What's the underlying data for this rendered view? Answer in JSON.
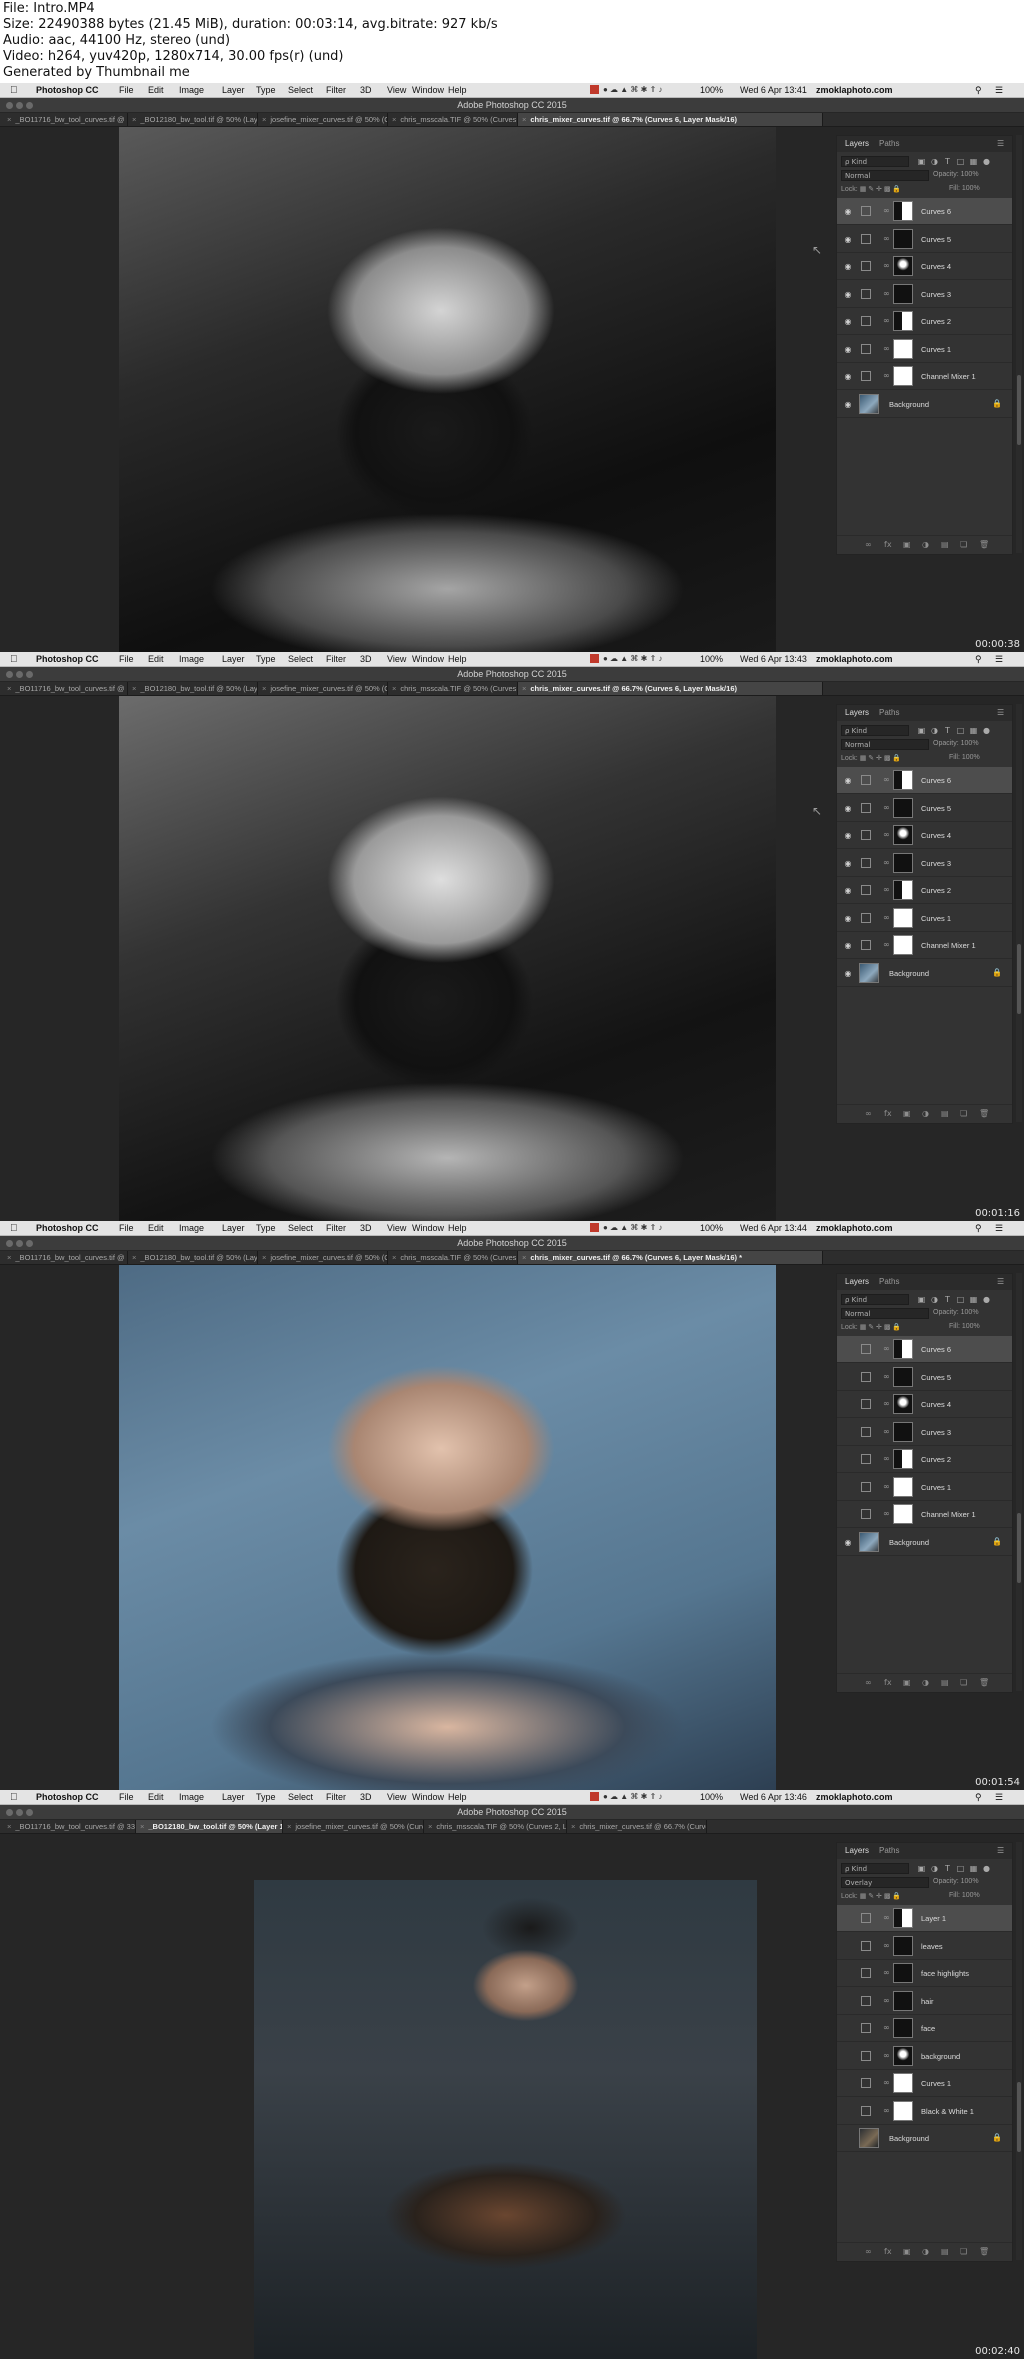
{
  "header": {
    "lines": [
      "File: Intro.MP4",
      "Size: 22490388 bytes (21.45 MiB), duration: 00:03:14, avg.bitrate: 927 kb/s",
      "Audio: aac, 44100 Hz, stereo (und)",
      "Video: h264, yuv420p, 1280x714, 30.00 fps(r) (und)",
      "Generated by Thumbnail me"
    ]
  },
  "menu": {
    "apple": "",
    "app": "Photoshop CC",
    "items": [
      "File",
      "Edit",
      "Image",
      "Layer",
      "Type",
      "Select",
      "Filter",
      "3D",
      "View",
      "Window",
      "Help"
    ],
    "battery": "100%",
    "user": "zmoklaphoto.com"
  },
  "window_title": "Adobe Photoshop CC 2015",
  "panel": {
    "tab_layers": "Layers",
    "tab_paths": "Paths",
    "kind": "ρ Kind",
    "opacity_label": "Opacity:",
    "fill_label": "Fill:",
    "lock_label": "Lock:",
    "icons": [
      "link-icon",
      "fx-icon",
      "mask-icon",
      "adjustment-icon",
      "folder-icon",
      "new-layer-icon",
      "trash-icon"
    ]
  },
  "frames": [
    {
      "time": "Wed 6 Apr 13:41",
      "timestamp": "00:00:38",
      "tabs": [
        "_BO11716_bw_tool_curves.tif @ 33.3%...",
        "_BO12180_bw_tool.tif @ 50% (Layer 1,...",
        "josefine_mixer_curves.tif @ 50% (Curve...",
        "chris_msscala.TIF @ 50% (Curves 2, La...",
        "chris_mixer_curves.tif @ 66.7% (Curves 6, Layer Mask/16)"
      ],
      "active_tab": 4,
      "blend": "Normal",
      "opacity": "100%",
      "fill": "100%",
      "layers": [
        {
          "name": "Curves 6",
          "thumb": "half",
          "sel": true
        },
        {
          "name": "Curves 5",
          "thumb": "dark"
        },
        {
          "name": "Curves 4",
          "thumb": "mostdark"
        },
        {
          "name": "Curves 3",
          "thumb": "dark"
        },
        {
          "name": "Curves 2",
          "thumb": "half"
        },
        {
          "name": "Curves 1",
          "thumb": "white"
        },
        {
          "name": "Channel Mixer 1",
          "thumb": "white"
        },
        {
          "name": "Background",
          "thumb": "bg",
          "lock": true
        }
      ]
    },
    {
      "time": "Wed 6 Apr 13:43",
      "timestamp": "00:01:16",
      "tabs": [
        "_BO11716_bw_tool_curves.tif @ 33.3%...",
        "_BO12180_bw_tool.tif @ 50% (Layer 1,...",
        "josefine_mixer_curves.tif @ 50% (Curve...",
        "chris_msscala.TIF @ 50% (Curves 2, La...",
        "chris_mixer_curves.tif @ 66.7% (Curves 6, Layer Mask/16)"
      ],
      "active_tab": 4,
      "blend": "Normal",
      "opacity": "100%",
      "fill": "100%",
      "layers": [
        {
          "name": "Curves 6",
          "thumb": "half",
          "sel": true
        },
        {
          "name": "Curves 5",
          "thumb": "dark"
        },
        {
          "name": "Curves 4",
          "thumb": "mostdark"
        },
        {
          "name": "Curves 3",
          "thumb": "dark"
        },
        {
          "name": "Curves 2",
          "thumb": "half"
        },
        {
          "name": "Curves 1",
          "thumb": "white"
        },
        {
          "name": "Channel Mixer 1",
          "thumb": "white"
        },
        {
          "name": "Background",
          "thumb": "bg",
          "lock": true
        }
      ]
    },
    {
      "time": "Wed 6 Apr 13:44",
      "timestamp": "00:01:54",
      "tabs": [
        "_BO11716_bw_tool_curves.tif @ 33.3%...",
        "_BO12180_bw_tool.tif @ 50% (Layer 1,...",
        "josefine_mixer_curves.tif @ 50% (Curv...",
        "chris_msscala.TIF @ 50% (Curves 2, La...",
        "chris_mixer_curves.tif @ 66.7% (Curves 6, Layer Mask/16) *"
      ],
      "active_tab": 4,
      "blend": "Normal",
      "opacity": "100%",
      "fill": "100%",
      "layers": [
        {
          "name": "Curves 6",
          "thumb": "half",
          "sel": true,
          "hidden": true
        },
        {
          "name": "Curves 5",
          "thumb": "dark",
          "hidden": true
        },
        {
          "name": "Curves 4",
          "thumb": "mostdark",
          "hidden": true
        },
        {
          "name": "Curves 3",
          "thumb": "dark",
          "hidden": true
        },
        {
          "name": "Curves 2",
          "thumb": "half",
          "hidden": true
        },
        {
          "name": "Curves 1",
          "thumb": "white",
          "hidden": true
        },
        {
          "name": "Channel Mixer 1",
          "thumb": "white",
          "hidden": true
        },
        {
          "name": "Background",
          "thumb": "bg",
          "lock": true
        }
      ]
    },
    {
      "time": "Wed 6 Apr 13:46",
      "timestamp": "00:02:40",
      "tabs": [
        "_BO11716_bw_tool_curves.tif @ 33.3% (s...",
        "_BO12180_bw_tool.tif @ 50% (Layer 1, RGB/16*) *",
        "josefine_mixer_curves.tif @ 50% (Curves ...",
        "chris_msscala.TIF @ 50% (Curves 2, Laye...",
        "chris_mixer_curves.tif @ 66.7% (Curves 6..."
      ],
      "active_tab": 1,
      "blend": "Overlay",
      "opacity": "100%",
      "fill": "100%",
      "layers": [
        {
          "name": "Layer 1",
          "thumb": "half",
          "sel": true,
          "hidden": true
        },
        {
          "name": "leaves",
          "thumb": "dark",
          "hidden": true
        },
        {
          "name": "face highlights",
          "thumb": "dark",
          "hidden": true
        },
        {
          "name": "hair",
          "thumb": "dark",
          "hidden": true
        },
        {
          "name": "face",
          "thumb": "dark",
          "hidden": true
        },
        {
          "name": "background",
          "thumb": "mostdark",
          "hidden": true
        },
        {
          "name": "Curves 1",
          "thumb": "white",
          "hidden": true
        },
        {
          "name": "Black & White 1",
          "thumb": "white",
          "hidden": true
        },
        {
          "name": "Background",
          "thumb": "bgdark",
          "lock": true,
          "hidden": true
        }
      ]
    }
  ]
}
